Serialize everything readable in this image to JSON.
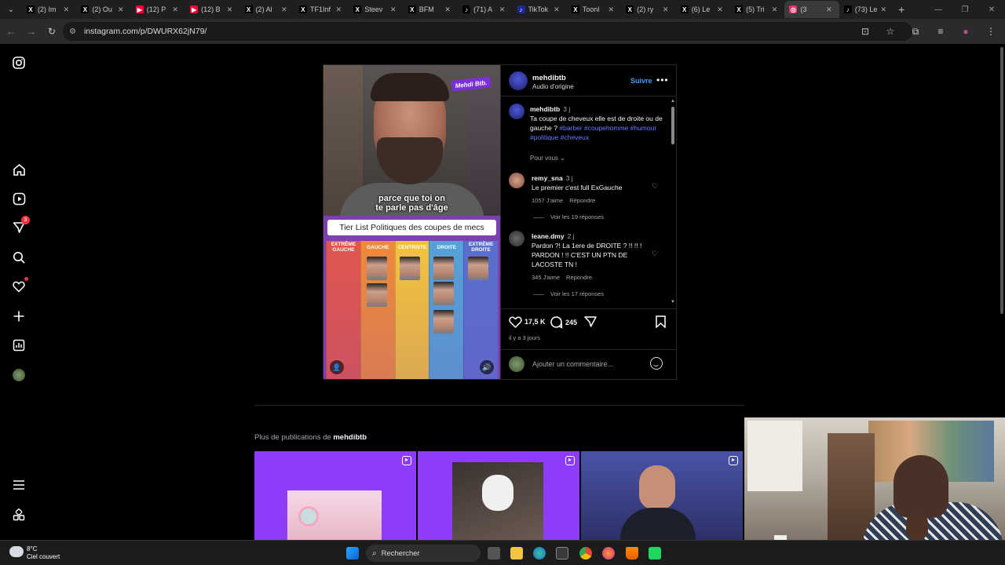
{
  "tabs": [
    {
      "label": "(2) Im",
      "icon": "x-icon",
      "color": "#000000"
    },
    {
      "label": "(2) Ou",
      "icon": "x-icon",
      "color": "#000000"
    },
    {
      "label": "(12) P",
      "icon": "youtube-icon",
      "color": "#ff0033"
    },
    {
      "label": "(12) B",
      "icon": "youtube-icon",
      "color": "#ff0033"
    },
    {
      "label": "(2) Al",
      "icon": "x-icon",
      "color": "#000000"
    },
    {
      "label": "TF1Inf",
      "icon": "x-icon",
      "color": "#000000"
    },
    {
      "label": "Steev",
      "icon": "x-icon",
      "color": "#000000"
    },
    {
      "label": "BFM",
      "icon": "x-icon",
      "color": "#000000"
    },
    {
      "label": "(71) A",
      "icon": "tiktok-icon",
      "color": "#000000"
    },
    {
      "label": "TikTok",
      "icon": "tiktok-icon",
      "color": "#1f2a9a"
    },
    {
      "label": "Toonl",
      "icon": "x-icon",
      "color": "#000000"
    },
    {
      "label": "(2) ry",
      "icon": "x-icon",
      "color": "#000000"
    },
    {
      "label": "(6) Le",
      "icon": "x-icon",
      "color": "#000000"
    },
    {
      "label": "(5) Tri",
      "icon": "x-icon",
      "color": "#000000"
    },
    {
      "label": "(3",
      "icon": "instagram-icon",
      "color": "#e1306c",
      "active": true
    },
    {
      "label": "(73) Le",
      "icon": "tiktok-icon",
      "color": "#000000"
    }
  ],
  "address": {
    "url": "instagram.com/p/DWURX62jN79/"
  },
  "sidebar": {
    "notification_count": "3"
  },
  "post": {
    "brand_badge": "Mehdi Btb.",
    "subtitle_line1": "parce que toi on",
    "subtitle_line2": "te parle pas d'âge",
    "tier_title": "Tier List Politiques des coupes de mecs",
    "tier_columns": [
      {
        "label": "EXTRÊME GAUCHE",
        "color": "#e0574e"
      },
      {
        "label": "GAUCHE",
        "color": "#ef8a3c"
      },
      {
        "label": "CENTRISTE",
        "color": "#f3c33c"
      },
      {
        "label": "DROITE",
        "color": "#55a2d8"
      },
      {
        "label": "EXTRÊME DROITE",
        "color": "#5a6fcf"
      }
    ],
    "username": "mehdibtb",
    "audio": "Audio d'origine",
    "follow": "Suivre",
    "caption": {
      "user": "mehdibtb",
      "time": "3 j",
      "text": "Ta coupe de cheveux elle est de droite ou de gauche ?",
      "hashtags": "#barber #coupehomme #humour #politique #cheveux"
    },
    "pour_vous": "Pour vous",
    "comments": [
      {
        "user": "remy_sna",
        "time": "3 j",
        "text": "Le premier c'est full ExGauche",
        "likes": "1057 J'aime",
        "reply": "Répondre",
        "replies": "Voir les 19 réponses"
      },
      {
        "user": "leane.dmy",
        "time": "2 j",
        "text": "Pardon ?! La 1ere de DROITE ? !! !! ! PARDON ! !! C'EST UN PTN DE LACOSTE TN !",
        "likes": "345 J'aime",
        "reply": "Répondre",
        "replies": "Voir les 17 réponses"
      }
    ],
    "likes": "17,5 K",
    "comments_count": "245",
    "date": "il y a 3 jours",
    "add_comment": "Ajouter un commentaire..."
  },
  "more": {
    "prefix": "Plus de publications de",
    "user": "mehdibtb"
  },
  "taskbar": {
    "temp": "8°C",
    "weather": "Ciel couvert",
    "search": "Rechercher"
  },
  "colors": {
    "accent": "#4a9cff",
    "hashtag": "#6b7cff",
    "grid_bg": "#8e3cf7"
  }
}
